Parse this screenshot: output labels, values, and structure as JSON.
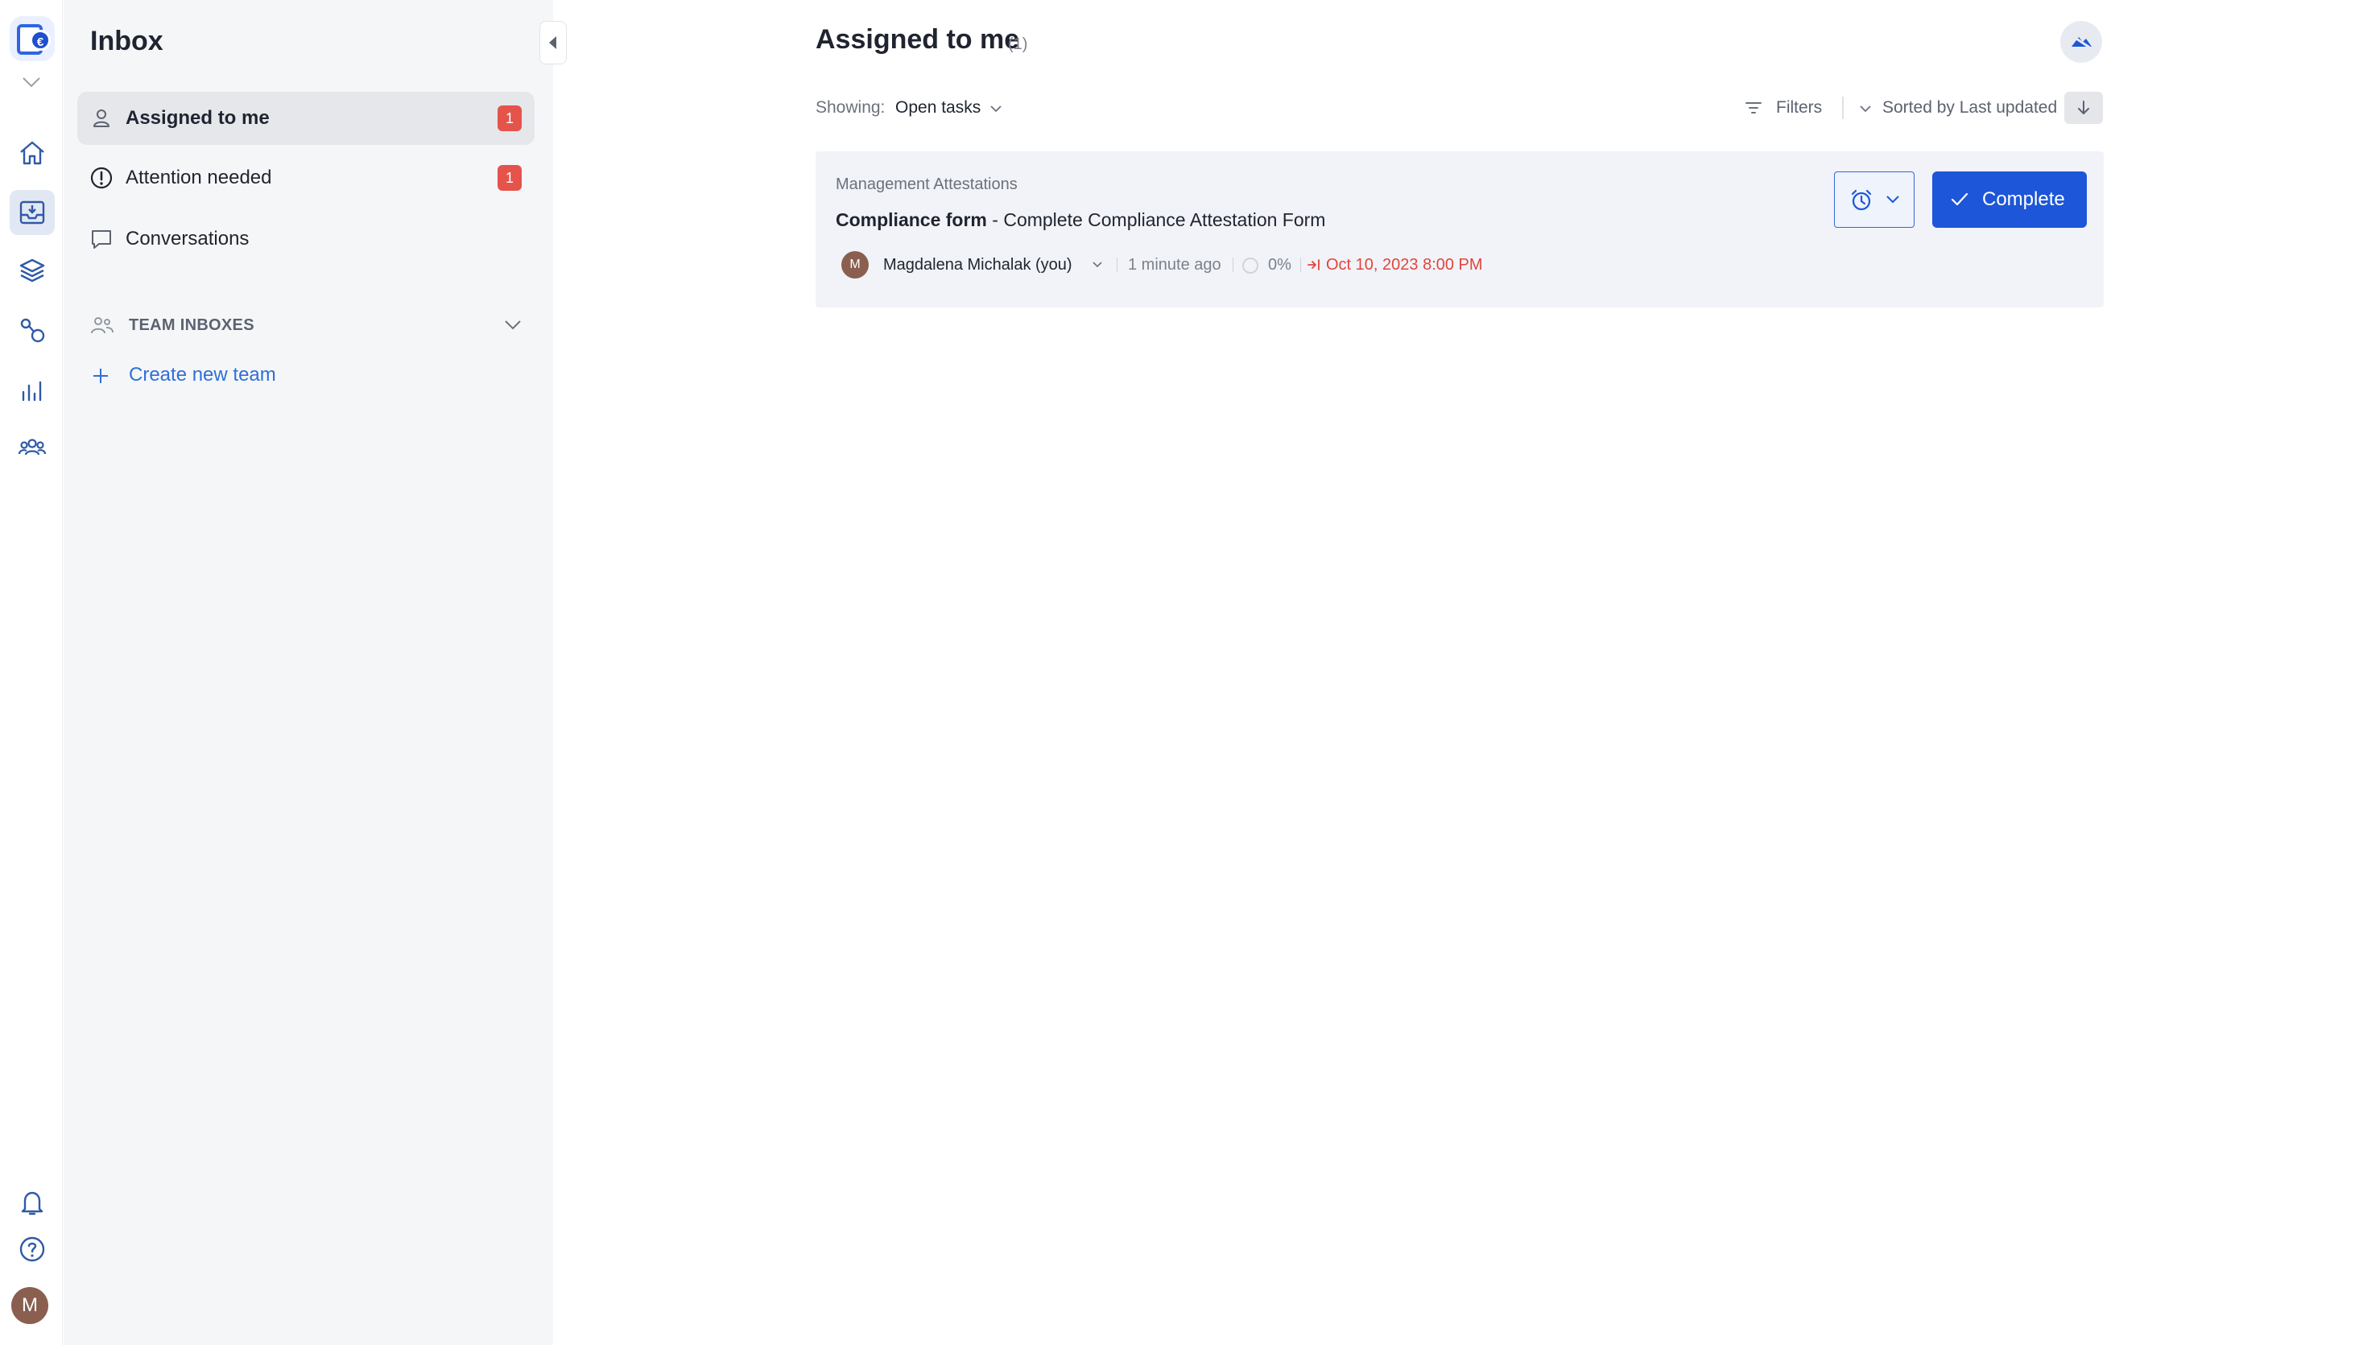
{
  "rail": {
    "logo_symbol": "€",
    "items": [
      {
        "name": "home-icon",
        "active": false
      },
      {
        "name": "inbox-icon",
        "active": true
      },
      {
        "name": "layers-icon",
        "active": false
      },
      {
        "name": "workflow-icon",
        "active": false
      },
      {
        "name": "analytics-icon",
        "active": false
      },
      {
        "name": "people-icon",
        "active": false
      }
    ],
    "bottom": [
      "bell-icon",
      "help-icon"
    ],
    "avatar_initial": "M"
  },
  "panel": {
    "title": "Inbox",
    "items": [
      {
        "label": "Assigned to me",
        "icon": "user-icon",
        "badge": "1",
        "active": true
      },
      {
        "label": "Attention needed",
        "icon": "alert-circle-icon",
        "badge": "1",
        "active": false
      },
      {
        "label": "Conversations",
        "icon": "chat-icon",
        "badge": "",
        "active": false
      }
    ],
    "team_section_label": "TEAM INBOXES",
    "create_team_label": "Create new team"
  },
  "main": {
    "title": "Assigned to me",
    "count": "(1)",
    "showing_label": "Showing:",
    "showing_value": "Open tasks",
    "filters_label": "Filters",
    "sort_label": "Sorted by Last updated"
  },
  "task": {
    "category": "Management Attestations",
    "title_bold": "Compliance form",
    "title_separator": " - ",
    "title_rest": "Complete Compliance Attestation Form",
    "assignee_initial": "M",
    "assignee": "Magdalena Michalak (you)",
    "updated": "1 minute ago",
    "progress": "0%",
    "due": "Oct 10, 2023 8:00 PM",
    "complete_label": "Complete"
  },
  "colors": {
    "accent": "#1d56d8",
    "badge": "#e5534b",
    "due": "#e2453c",
    "link": "#2f6fd6"
  }
}
